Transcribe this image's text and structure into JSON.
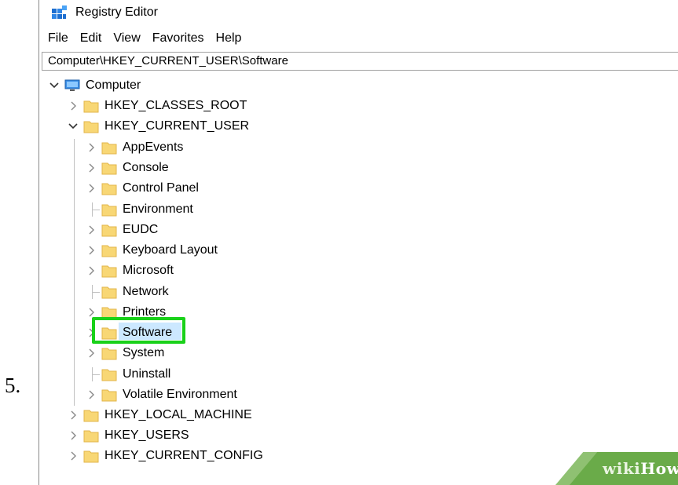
{
  "step_number": "5.",
  "window": {
    "title": "Registry Editor",
    "app_icon": "registry-editor-icon"
  },
  "menu": [
    "File",
    "Edit",
    "View",
    "Favorites",
    "Help"
  ],
  "address": "Computer\\HKEY_CURRENT_USER\\Software",
  "tree": {
    "root": {
      "label": "Computer",
      "icon": "computer-icon",
      "expanded": true
    },
    "hives": [
      {
        "label": "HKEY_CLASSES_ROOT",
        "expanded": false
      },
      {
        "label": "HKEY_CURRENT_USER",
        "expanded": true
      },
      {
        "label": "HKEY_LOCAL_MACHINE",
        "expanded": false
      },
      {
        "label": "HKEY_USERS",
        "expanded": false
      },
      {
        "label": "HKEY_CURRENT_CONFIG",
        "expanded": false
      }
    ],
    "current_user_children": [
      {
        "label": "AppEvents",
        "has_children": true
      },
      {
        "label": "Console",
        "has_children": true
      },
      {
        "label": "Control Panel",
        "has_children": true
      },
      {
        "label": "Environment",
        "has_children": false
      },
      {
        "label": "EUDC",
        "has_children": true
      },
      {
        "label": "Keyboard Layout",
        "has_children": true
      },
      {
        "label": "Microsoft",
        "has_children": true
      },
      {
        "label": "Network",
        "has_children": false
      },
      {
        "label": "Printers",
        "has_children": true
      },
      {
        "label": "Software",
        "has_children": true,
        "selected": true
      },
      {
        "label": "System",
        "has_children": true
      },
      {
        "label": "Uninstall",
        "has_children": false
      },
      {
        "label": "Volatile Environment",
        "has_children": true
      }
    ]
  },
  "highlight_color": "#19d119",
  "folder_color": "#f8d775",
  "watermark": {
    "prefix": "wiki",
    "suffix": "How"
  }
}
